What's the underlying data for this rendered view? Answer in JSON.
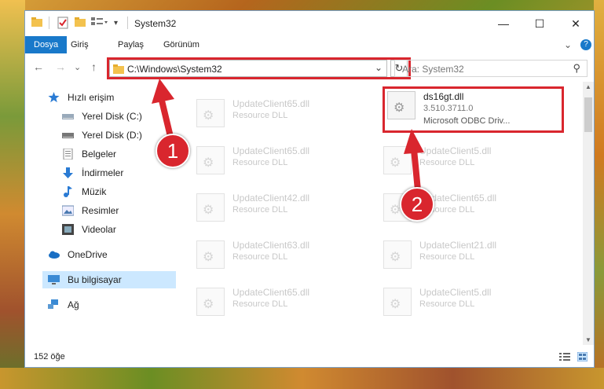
{
  "window": {
    "title": "System32",
    "minimize": "—",
    "maximize": "☐",
    "close": "✕"
  },
  "ribbon": {
    "tabs": [
      "Dosya",
      "Giriş",
      "Paylaş",
      "Görünüm"
    ],
    "expand": "⌄",
    "help": "?"
  },
  "nav": {
    "back": "←",
    "forward": "→",
    "recent": "⌄",
    "up": "↑",
    "address": "C:\\Windows\\System32",
    "address_dropdown": "⌄",
    "refresh": "↻",
    "search_placeholder": "Ara: System32",
    "search_icon": "⚲"
  },
  "sidebar": {
    "items": [
      {
        "label": "Hızlı erişim",
        "icon": "star-icon"
      },
      {
        "label": "Yerel Disk (C:)",
        "icon": "drive-icon"
      },
      {
        "label": "Yerel Disk (D:)",
        "icon": "drive-icon"
      },
      {
        "label": "Belgeler",
        "icon": "documents-icon"
      },
      {
        "label": "İndirmeler",
        "icon": "download-icon"
      },
      {
        "label": "Müzik",
        "icon": "music-icon"
      },
      {
        "label": "Resimler",
        "icon": "pictures-icon"
      },
      {
        "label": "Videolar",
        "icon": "video-icon"
      },
      {
        "label": "OneDrive",
        "icon": "cloud-icon"
      },
      {
        "label": "Bu bilgisayar",
        "icon": "computer-icon"
      },
      {
        "label": "Ağ",
        "icon": "network-icon"
      }
    ],
    "pin": "📌"
  },
  "files": {
    "highlighted": {
      "name": "ds16gt.dll",
      "version": "3.510.3711.0",
      "desc": "Microsoft ODBC Driv..."
    },
    "left": [
      {
        "name": "UpdateClient65.dll",
        "sub": "Resource DLL"
      },
      {
        "name": "UpdateClient65.dll",
        "sub": "Resource DLL"
      },
      {
        "name": "UpdateClient42.dll",
        "sub": "Resource DLL"
      },
      {
        "name": "UpdateClient63.dll",
        "sub": "Resource DLL"
      },
      {
        "name": "UpdateClient65.dll",
        "sub": "Resource DLL"
      }
    ],
    "right": [
      {
        "name": "UpdateClient5.dll",
        "sub": "Resource DLL"
      },
      {
        "name": "UpdateClient65.dll",
        "sub": "Resource DLL"
      },
      {
        "name": "UpdateClient21.dll",
        "sub": "Resource DLL"
      },
      {
        "name": "UpdateClient5.dll",
        "sub": "Resource DLL"
      }
    ]
  },
  "status": {
    "count": "152 öğe"
  },
  "annotations": {
    "badge1": "1",
    "badge2": "2",
    "color": "#d9262e"
  }
}
